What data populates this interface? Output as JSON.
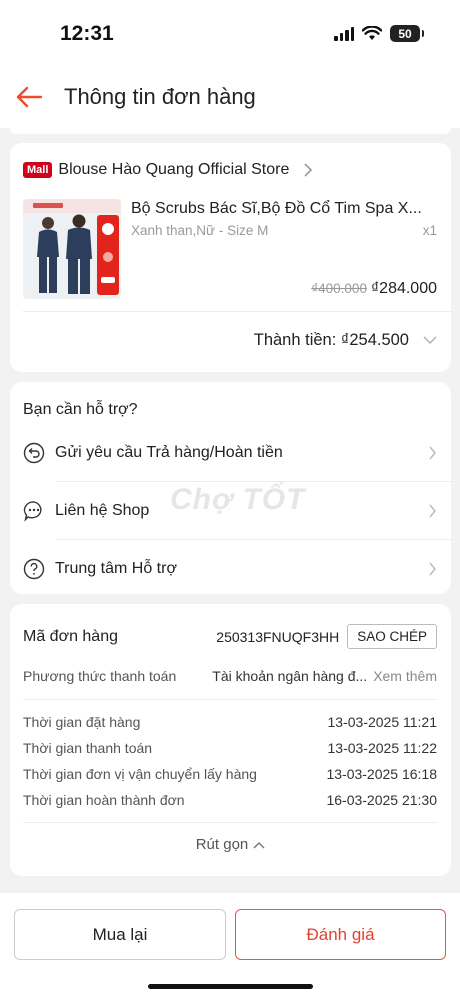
{
  "status_bar": {
    "time": "12:31",
    "battery": "50"
  },
  "header": {
    "title": "Thông tin đơn hàng"
  },
  "order_item": {
    "mall_badge": "Mall",
    "store_name": "Blouse Hào Quang Official Store",
    "product_title": "Bộ Scrubs Bác Sĩ,Bộ Đồ Cổ Tim Spa X...",
    "variant": "Xanh than,Nữ - Size M",
    "quantity": "x1",
    "original_price": "₫400.000",
    "price": "₫284.000",
    "total_label": "Thành tiền: ₫254.500"
  },
  "support": {
    "title": "Bạn cần hỗ trợ?",
    "items": [
      {
        "label": "Gửi yêu cầu Trả hàng/Hoàn tiền",
        "icon": "return-icon"
      },
      {
        "label": "Liên hệ Shop",
        "icon": "chat-icon"
      },
      {
        "label": "Trung tâm Hỗ trợ",
        "icon": "help-icon"
      }
    ]
  },
  "order_info": {
    "order_id_label": "Mã đơn hàng",
    "order_id": "250313FNUQF3HH",
    "copy_label": "SAO CHÉP",
    "payment_label": "Phương thức thanh toán",
    "payment_value": "Tài khoản ngân hàng đ...",
    "see_more": "Xem thêm",
    "timeline": [
      {
        "label": "Thời gian đặt hàng",
        "value": "13-03-2025 11:21"
      },
      {
        "label": "Thời gian thanh toán",
        "value": "13-03-2025 11:22"
      },
      {
        "label": "Thời gian đơn vị vận chuyển lấy hàng",
        "value": "13-03-2025 16:18"
      },
      {
        "label": "Thời gian hoàn thành đơn",
        "value": "16-03-2025 21:30"
      }
    ],
    "collapse_label": "Rút gọn"
  },
  "actions": {
    "rebuy": "Mua lại",
    "rate": "Đánh giá"
  },
  "watermark": "Chợ TỐT",
  "colors": {
    "accent": "#ee4d2d",
    "mall": "#d0011b"
  }
}
